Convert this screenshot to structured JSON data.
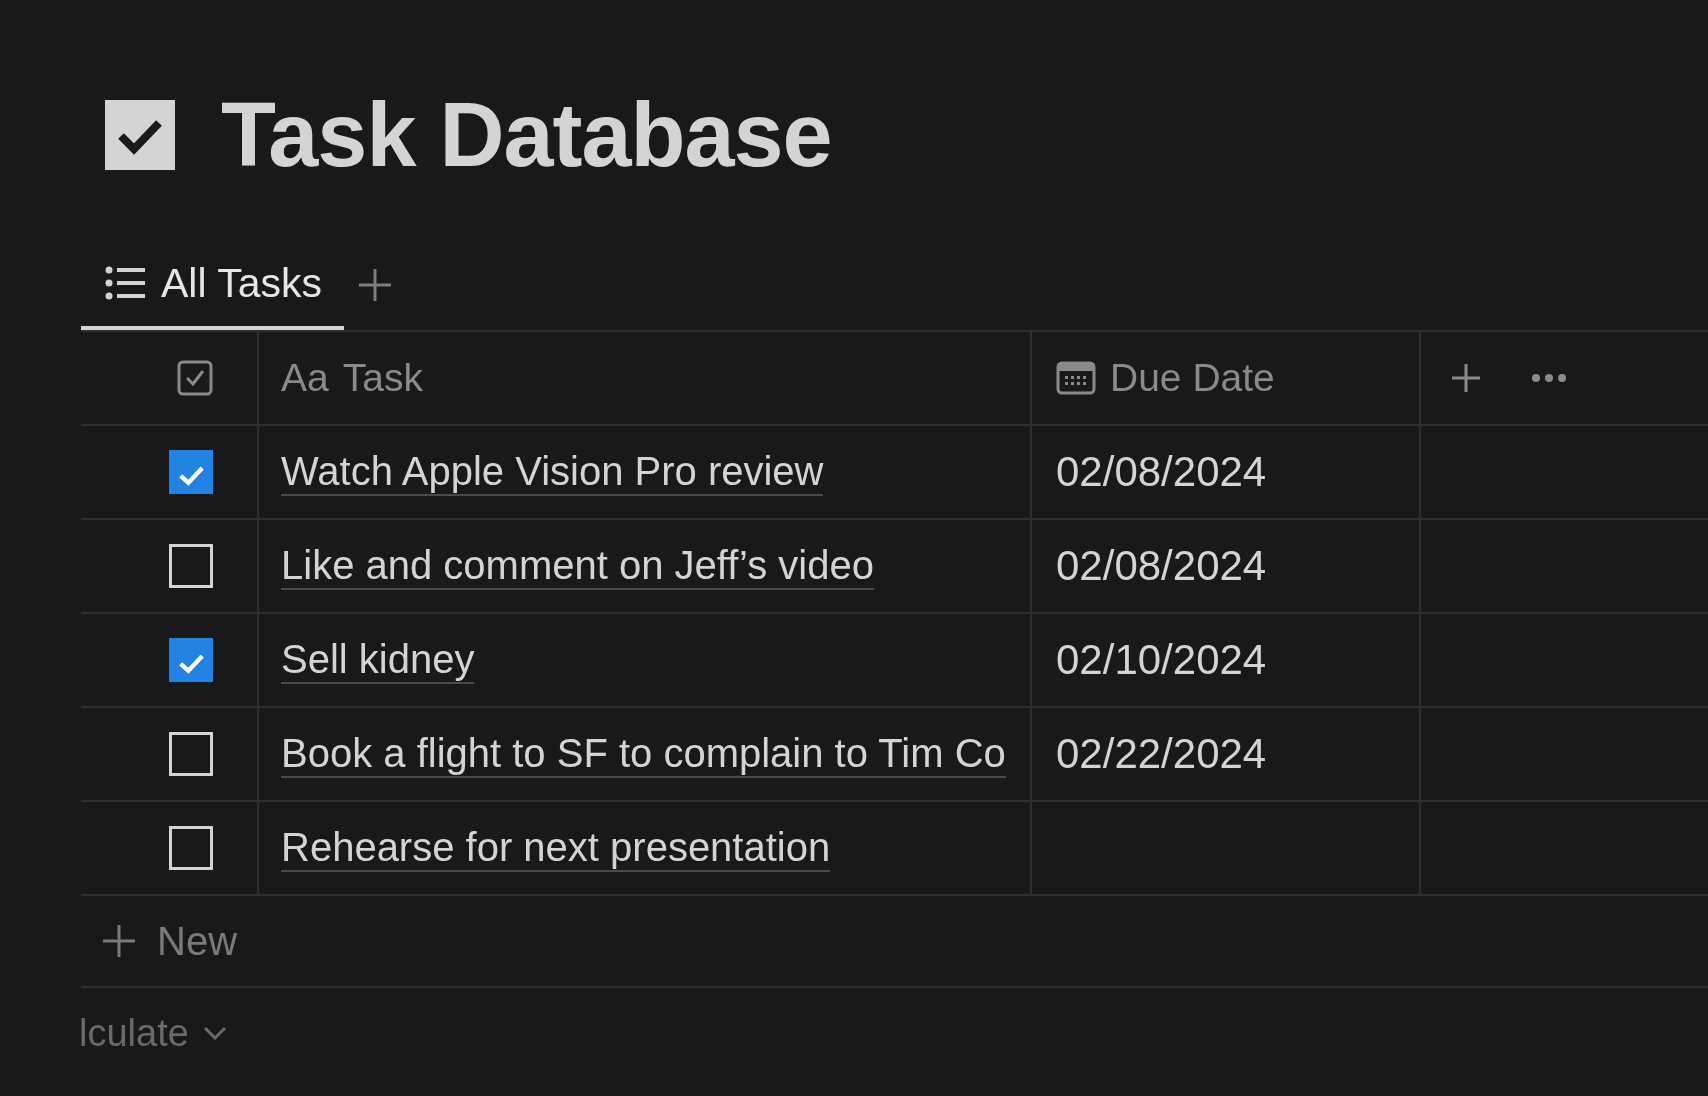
{
  "page": {
    "title": "Task Database"
  },
  "views": [
    {
      "label": "All Tasks",
      "selected": true
    }
  ],
  "table": {
    "columns": [
      {
        "kind": "check"
      },
      {
        "kind": "title",
        "prefix": "Aa",
        "label": "Task"
      },
      {
        "kind": "date",
        "label": "Due Date"
      }
    ],
    "rows": [
      {
        "checked": true,
        "task": "Watch Apple Vision Pro review",
        "due": "02/08/2024"
      },
      {
        "checked": false,
        "task": "Like and comment on Jeff’s video",
        "due": "02/08/2024"
      },
      {
        "checked": true,
        "task": "Sell kidney",
        "due": "02/10/2024"
      },
      {
        "checked": false,
        "task": "Book a flight to SF to complain to Tim Co",
        "due": "02/22/2024"
      },
      {
        "checked": false,
        "task": "Rehearse for next presentation"
      }
    ],
    "new_label": "New",
    "calculate_label": "lculate"
  }
}
